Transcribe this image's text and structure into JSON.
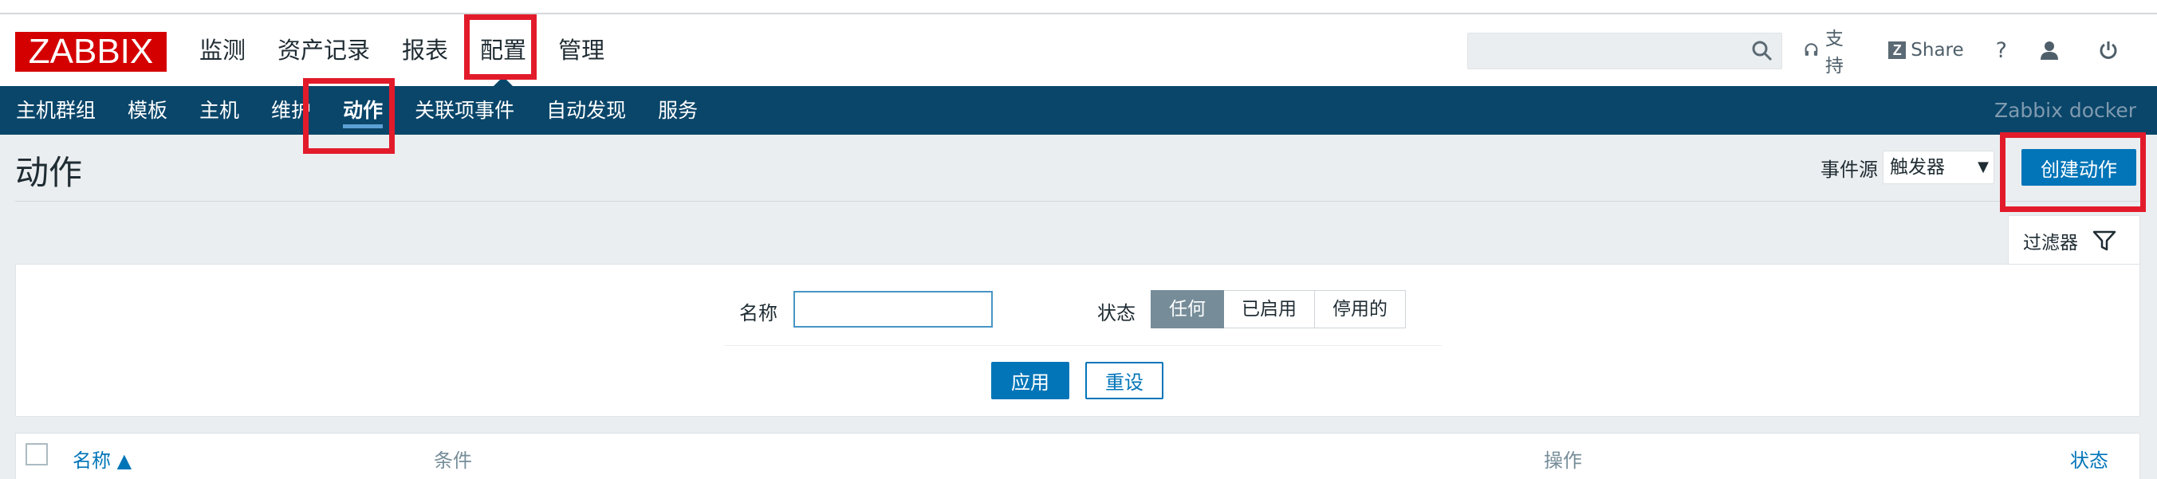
{
  "header": {
    "logo": "ZABBIX",
    "menu": [
      "监测",
      "资产记录",
      "报表",
      "配置",
      "管理"
    ],
    "selected_menu": "配置",
    "links": {
      "support": "支持",
      "share": "Share",
      "help": "?"
    }
  },
  "subnav": {
    "items": [
      "主机群组",
      "模板",
      "主机",
      "维护",
      "动作",
      "关联项事件",
      "自动发现",
      "服务"
    ],
    "selected": "动作",
    "server_name": "Zabbix docker"
  },
  "page": {
    "title": "动作",
    "event_source_label": "事件源",
    "event_source_value": "触发器",
    "create_button": "创建动作"
  },
  "filter": {
    "tab_label": "过滤器",
    "name_label": "名称",
    "name_value": "",
    "status_label": "状态",
    "status_options": [
      "任何",
      "已启用",
      "停用的"
    ],
    "status_selected": "任何",
    "apply_button": "应用",
    "reset_button": "重设"
  },
  "table": {
    "columns": [
      "名称 ▲",
      "条件",
      "操作",
      "状态"
    ]
  },
  "colors": {
    "logo_red": "#d40000",
    "nav_blue": "#0a466a",
    "accent_blue": "#0275b8",
    "annotation_red": "#e21b2b"
  }
}
